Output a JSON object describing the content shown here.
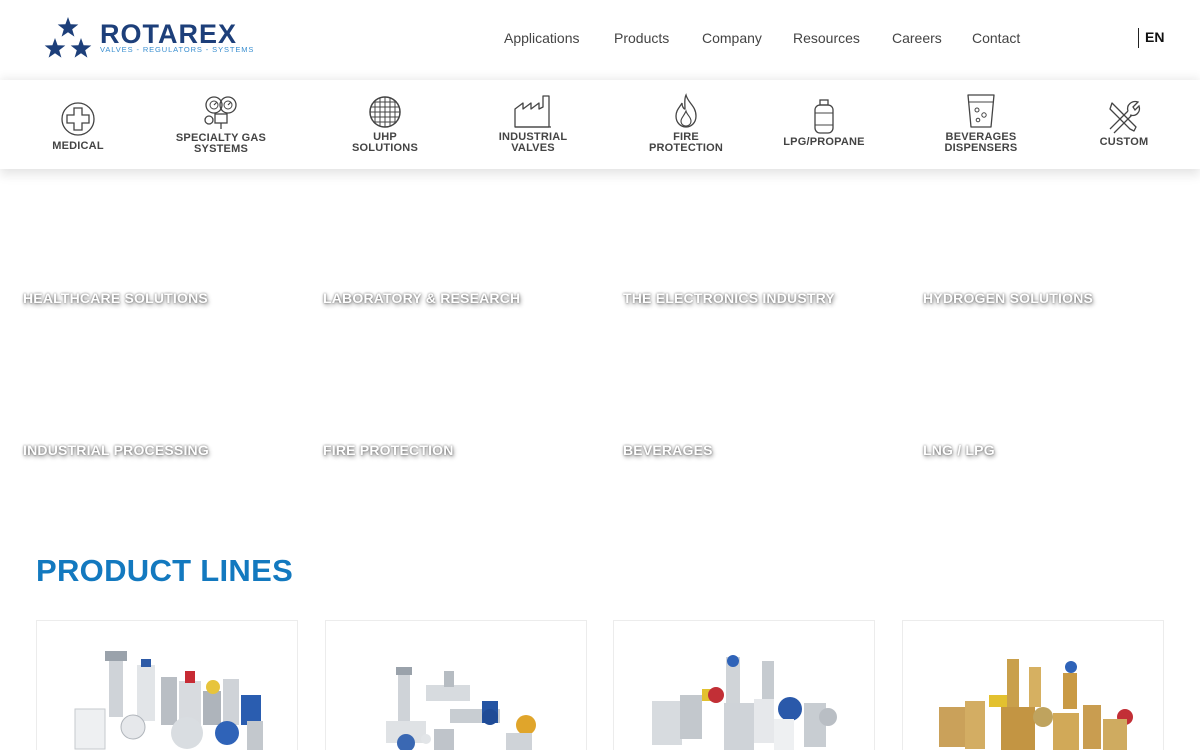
{
  "brand": {
    "name": "ROTAREX",
    "tagline": "VALVES - REGULATORS - SYSTEMS",
    "primary_color": "#1d3f7a",
    "accent_color": "#1379bf"
  },
  "nav": {
    "items": [
      "Applications",
      "Products",
      "Company",
      "Resources",
      "Careers",
      "Contact"
    ],
    "language": "EN"
  },
  "categories": [
    {
      "label": "MEDICAL",
      "icon": "medical-cross-icon"
    },
    {
      "label": "SPECIALTY GAS\nSYSTEMS",
      "icon": "gauges-icon"
    },
    {
      "label": "UHP\nSOLUTIONS",
      "icon": "wafer-grid-icon"
    },
    {
      "label": "INDUSTRIAL\nVALVES",
      "icon": "factory-icon"
    },
    {
      "label": "FIRE\nPROTECTION",
      "icon": "flame-icon"
    },
    {
      "label": "LPG/PROPANE",
      "icon": "gas-tank-icon"
    },
    {
      "label": "BEVERAGES\nDISPENSERS",
      "icon": "beverage-glass-icon"
    },
    {
      "label": "CUSTOM",
      "icon": "tools-icon"
    }
  ],
  "applications": [
    "HEALTHCARE SOLUTIONS",
    "LABORATORY & RESEARCH",
    "THE ELECTRONICS INDUSTRY",
    "HYDROGEN SOLUTIONS",
    "INDUSTRIAL PROCESSING",
    "FIRE PROTECTION",
    "BEVERAGES",
    "LNG / LPG"
  ],
  "product_lines": {
    "title": "PRODUCT LINES",
    "cards": [
      {
        "image": "medical-valves-product-image"
      },
      {
        "image": "specialty-gas-regulators-product-image"
      },
      {
        "image": "industrial-valves-product-image"
      },
      {
        "image": "brass-valves-product-image"
      }
    ]
  }
}
